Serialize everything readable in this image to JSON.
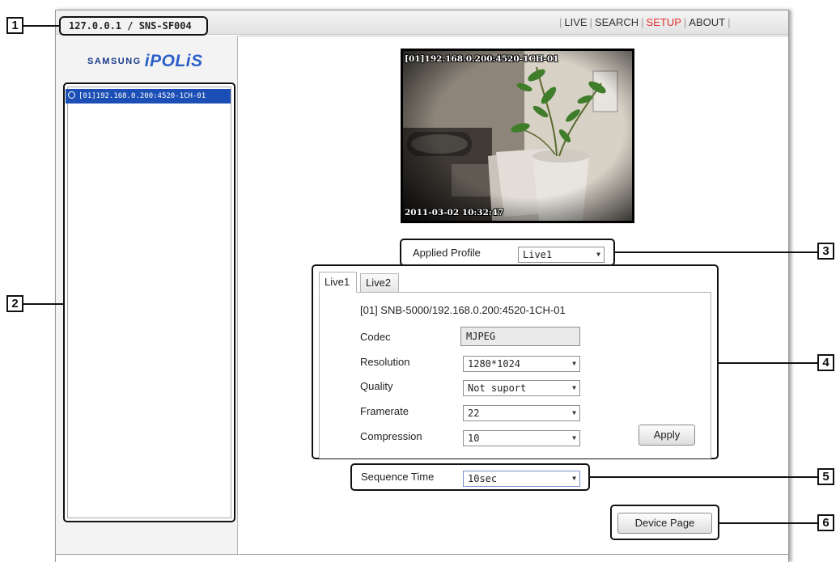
{
  "window": {
    "address": "127.0.0.1 / SNS-SF004"
  },
  "nav": {
    "items": [
      {
        "label": "LIVE",
        "active": false
      },
      {
        "label": "SEARCH",
        "active": false
      },
      {
        "label": "SETUP",
        "active": true
      },
      {
        "label": "ABOUT",
        "active": false
      }
    ],
    "active_color": "#e2302e"
  },
  "logo": {
    "brand": "SAMSUNG",
    "product": "iPOLiS"
  },
  "device_tree": {
    "items": [
      {
        "label": "[01]192.168.0.200:4520-1CH-01",
        "selected": true,
        "icon": "camera-icon"
      }
    ],
    "selected_color": "#1c4fb5"
  },
  "video": {
    "osd_top": "[01]192.168.0.200:4520-1CH-01",
    "osd_bottom": "2011-03-02 10:32:47"
  },
  "applied_profile": {
    "label": "Applied Profile",
    "value": "Live1"
  },
  "profile_tabs": {
    "tabs": [
      {
        "label": "Live1",
        "active": true
      },
      {
        "label": "Live2",
        "active": false
      }
    ],
    "device_line": "[01] SNB-5000/192.168.0.200:4520-1CH-01",
    "fields": {
      "codec": {
        "label": "Codec",
        "value": "MJPEG"
      },
      "resolution": {
        "label": "Resolution",
        "value": "1280*1024"
      },
      "quality": {
        "label": "Quality",
        "value": "Not suport"
      },
      "framerate": {
        "label": "Framerate",
        "value": "22"
      },
      "compression": {
        "label": "Compression",
        "value": "10"
      }
    },
    "apply_label": "Apply"
  },
  "sequence": {
    "label": "Sequence Time",
    "value": "10sec"
  },
  "device_page_label": "Device Page",
  "callouts": [
    "1",
    "2",
    "3",
    "4",
    "5",
    "6"
  ]
}
